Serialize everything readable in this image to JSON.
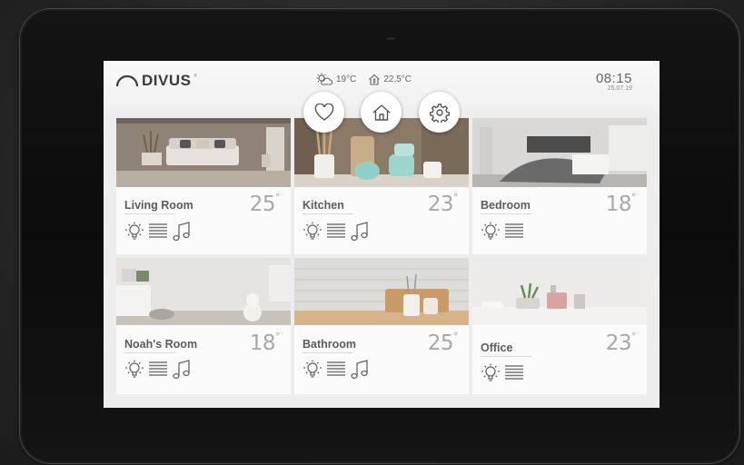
{
  "header": {
    "brand": "DIVUS",
    "brand_mark": "®",
    "outdoor_temp": "19°C",
    "indoor_temp": "22,5°C",
    "time": "08:15",
    "date": "25.07.19"
  },
  "nav": [
    {
      "name": "favorites-button",
      "icon": "heart-icon"
    },
    {
      "name": "home-button",
      "icon": "house-icon"
    },
    {
      "name": "settings-button",
      "icon": "gear-icon"
    }
  ],
  "rooms": [
    {
      "name": "Living Room",
      "temp": "25",
      "controls": [
        "light",
        "blinds",
        "music"
      ]
    },
    {
      "name": "Kitchen",
      "temp": "23",
      "controls": [
        "light",
        "blinds",
        "music"
      ]
    },
    {
      "name": "Bedroom",
      "temp": "18",
      "controls": [
        "light",
        "blinds"
      ]
    },
    {
      "name": "Noah's Room",
      "temp": "18",
      "controls": [
        "light",
        "blinds",
        "music"
      ]
    },
    {
      "name": "Bathroom",
      "temp": "25",
      "controls": [
        "light",
        "blinds",
        "music"
      ]
    },
    {
      "name": "Office",
      "temp": "23",
      "controls": [
        "light",
        "blinds"
      ]
    }
  ],
  "degree_symbol": "°",
  "colors": {
    "screen_bg": "#ededed",
    "card_bg": "#fbfbfb",
    "text": "#5c5c5c",
    "temp": "#a8a8a8"
  }
}
